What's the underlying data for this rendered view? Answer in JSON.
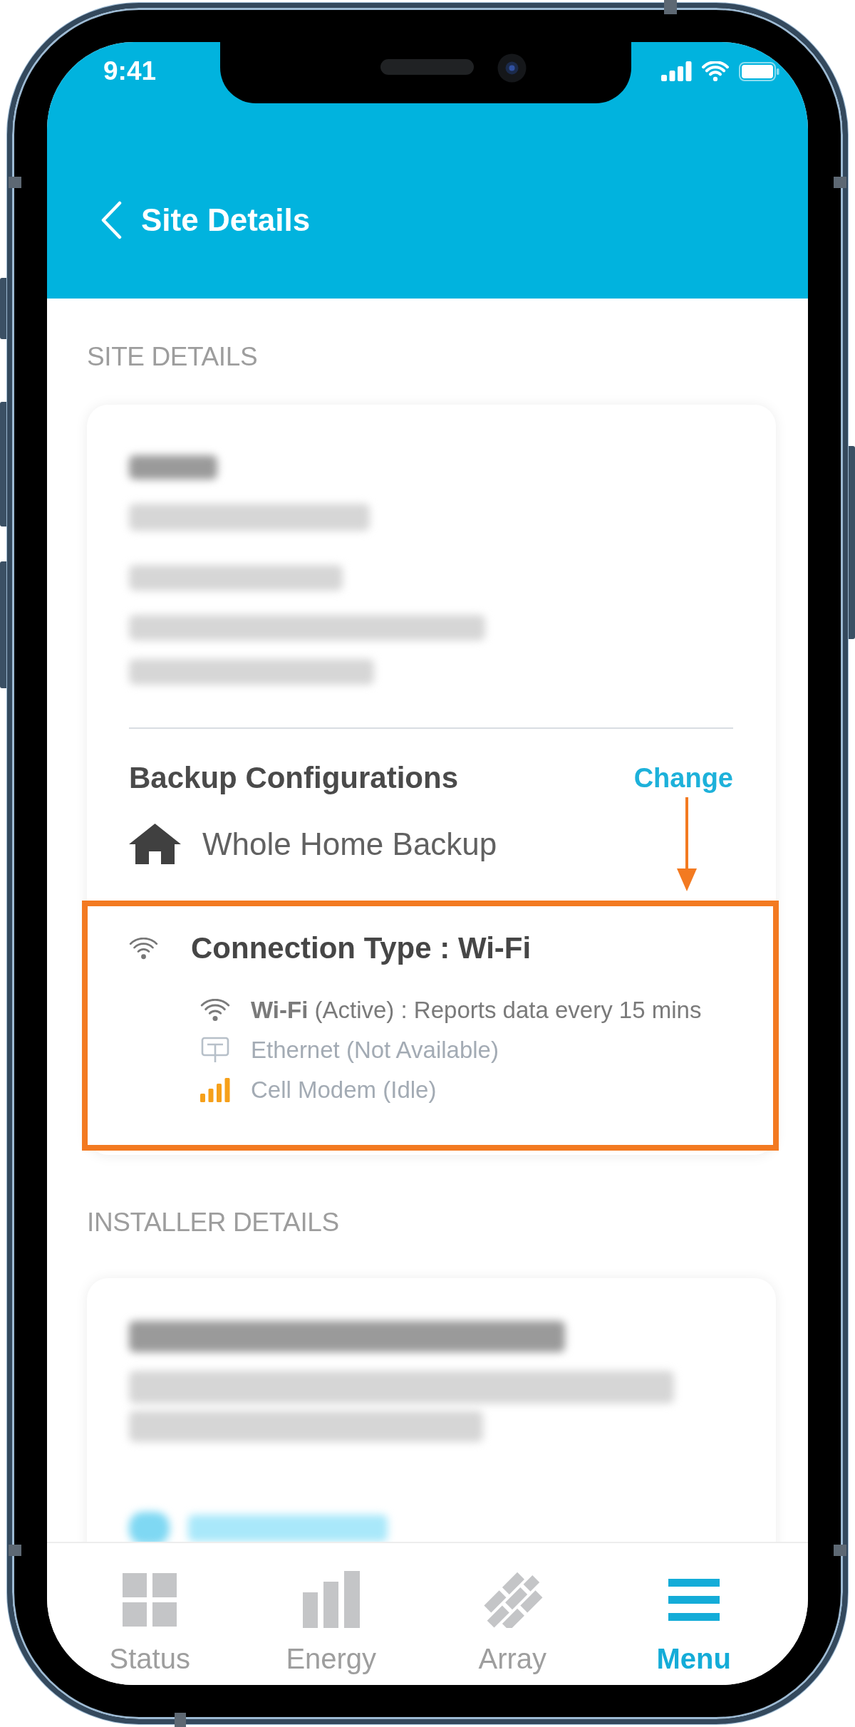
{
  "status_bar": {
    "time": "9:41"
  },
  "header": {
    "title": "Site Details"
  },
  "site_section": {
    "heading": "SITE DETAILS",
    "backup": {
      "label": "Backup Configurations",
      "action": "Change",
      "value": "Whole Home Backup"
    },
    "connection": {
      "title": "Connection Type : Wi-Fi",
      "options": [
        {
          "kind": "wifi",
          "text": "**Wi-Fi** (Active) : Reports data every 15 mins",
          "active": true
        },
        {
          "kind": "ethernet",
          "text": "Ethernet (Not Available)",
          "active": false
        },
        {
          "kind": "cell",
          "text": "Cell Modem (Idle)",
          "active": false
        }
      ]
    }
  },
  "installer_section": {
    "heading": "INSTALLER DETAILS"
  },
  "tab_bar": {
    "tabs": [
      {
        "kind": "status",
        "label": "Status",
        "selected": false
      },
      {
        "kind": "energy",
        "label": "Energy",
        "selected": false
      },
      {
        "kind": "array",
        "label": "Array",
        "selected": false
      },
      {
        "kind": "menu",
        "label": "Menu",
        "selected": true
      }
    ]
  }
}
